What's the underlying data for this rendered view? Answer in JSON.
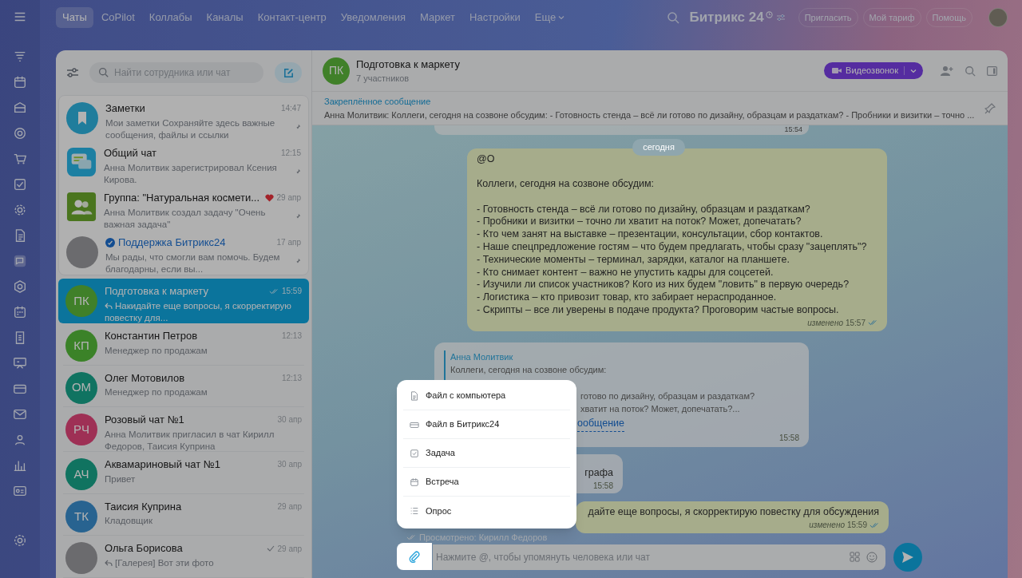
{
  "top_nav": {
    "items": [
      {
        "label": "Чаты",
        "selected": true
      },
      {
        "label": "CoPilot",
        "selected": false
      },
      {
        "label": "Коллабы",
        "selected": false
      },
      {
        "label": "Каналы",
        "selected": false
      },
      {
        "label": "Контакт-центр",
        "selected": false
      },
      {
        "label": "Уведомления",
        "selected": false
      },
      {
        "label": "Маркет",
        "selected": false
      },
      {
        "label": "Настройки",
        "selected": false
      }
    ],
    "more": "Еще",
    "brand": "Битрикс 24",
    "buttons": [
      "Пригласить",
      "Мой тариф",
      "Помощь"
    ]
  },
  "chat_list": {
    "search_placeholder": "Найти сотрудника или чат",
    "items": [
      {
        "title": "Заметки",
        "time": "14:47",
        "preview": "Мои заметки Сохраняйте здесь важные сообщения, файлы и ссылки",
        "kind": "notes",
        "pinned": true,
        "selected": false,
        "heart": false,
        "reply": false,
        "verified": false,
        "sent": false,
        "read": false
      },
      {
        "title": "Общий чат",
        "time": "12:15",
        "preview": "Анна Молитвик зарегистрировал Ксения Кирова.",
        "kind": "general",
        "pinned": true,
        "selected": false,
        "heart": false,
        "reply": false,
        "verified": false,
        "sent": false,
        "read": false
      },
      {
        "title": "Группа: \"Натуральная космети...",
        "time": "29 апр",
        "preview": "Анна Молитвик создал задачу \"Очень важная задача\"",
        "kind": "group",
        "pinned": true,
        "selected": false,
        "heart": true,
        "reply": false,
        "verified": false,
        "sent": false,
        "read": false
      },
      {
        "title": "Поддержка Битрикс24",
        "time": "17 апр",
        "preview": "Мы рады, что смогли вам помочь. Будем благодарны, если вы...",
        "kind": "photo",
        "pinned": true,
        "selected": false,
        "heart": false,
        "reply": false,
        "verified": true,
        "sent": false,
        "read": false
      },
      {
        "title": "Подготовка к маркету",
        "time": "15:59",
        "preview": "Накидайте еще вопросы, я скорректирую повестку для...",
        "kind": "initials",
        "initials": "ПК",
        "pinned": false,
        "selected": true,
        "heart": false,
        "reply": true,
        "verified": false,
        "sent": true,
        "read": true
      },
      {
        "title": "Константин Петров",
        "time": "12:13",
        "preview": "Менеджер по продажам",
        "kind": "initials",
        "initials": "КП",
        "pinned": false,
        "selected": false,
        "heart": false,
        "reply": false,
        "verified": false,
        "sent": false,
        "read": false
      },
      {
        "title": "Олег Мотовилов",
        "time": "12:13",
        "preview": "Менеджер по продажам",
        "kind": "initials",
        "initials": "ОМ",
        "pinned": false,
        "selected": false,
        "heart": false,
        "reply": false,
        "verified": false,
        "sent": false,
        "read": false
      },
      {
        "title": "Розовый чат №1",
        "time": "30 апр",
        "preview": "Анна Молитвик пригласил в чат Кирилл Федоров, Таисия Куприна",
        "kind": "initials",
        "initials": "РЧ",
        "pinned": false,
        "selected": false,
        "heart": false,
        "reply": false,
        "verified": false,
        "sent": false,
        "read": false
      },
      {
        "title": "Аквамариновый чат №1",
        "time": "30 апр",
        "preview": "Привет",
        "kind": "initials",
        "initials": "АЧ",
        "pinned": false,
        "selected": false,
        "heart": false,
        "reply": false,
        "verified": false,
        "sent": false,
        "read": false
      },
      {
        "title": "Таисия Куприна",
        "time": "29 апр",
        "preview": "Кладовщик",
        "kind": "initials",
        "initials": "ТК",
        "pinned": false,
        "selected": false,
        "heart": false,
        "reply": false,
        "verified": false,
        "sent": false,
        "read": false
      },
      {
        "title": "Ольга Борисова",
        "time": "29 апр",
        "preview": "[Галерея] Вот эти фото",
        "kind": "photo",
        "pinned": false,
        "selected": false,
        "heart": false,
        "reply": true,
        "verified": false,
        "sent": true,
        "read": false
      }
    ]
  },
  "chat": {
    "avatar_initials": "ПК",
    "title": "Подготовка к маркету",
    "subtitle": "7 участников",
    "video_button": "Видеозвонок",
    "pinned": {
      "label": "Закреплённое сообщение",
      "text": "Анна Молитвик: Коллеги, сегодня на созвоне обсудим: - Готовность стенда – всё ли готово по дизайну, образцам и раздаткам? - Пробники и визитки – точно ..."
    },
    "top_time": "15:54",
    "date_chip": "сегодня",
    "messages": [
      {
        "kind": "own",
        "text": "@О\n\nКоллеги, сегодня на созвоне обсудим:\n\n- Готовность стенда – всё ли готово по дизайну, образцам и раздаткам?\n- Пробники и визитки – точно ли хватит на поток? Может, допечатать?\n- Кто чем занят на выставке – презентации, консультации, сбор контактов.\n- Наше спецпредложение гостям – что будем предлагать, чтобы сразу \"зацеплять\"?\n- Технические моменты – терминал, зарядки, каталог на планшете.\n- Кто снимает контент – важно не упустить кадры для соцсетей.\n- Изучили ли список участников? Кого из них будем \"ловить\" в первую очередь?\n- Логистика – кто привозит товар, кто забирает нераспроданное.\n- Скрипты – все ли уверены в подаче продукта? Проговорим частые вопросы.",
        "edited": "изменено",
        "time": "15:57",
        "read": true
      },
      {
        "kind": "quote",
        "author": "Анна Молитвик",
        "text": "Коллеги, сегодня на созвоне обсудим:",
        "fragments": [
          "готово по дизайну, образцам и раздаткам?",
          "хватит на поток? Может, допечатать?..."
        ],
        "link": "ообщение",
        "time": "15:58"
      },
      {
        "kind": "incoming",
        "text": "графа",
        "time": "15:58"
      },
      {
        "kind": "own",
        "text": "дайте еще вопросы, я скорректирую повестку для обсуждения",
        "edited": "изменено",
        "time": "15:59",
        "read": true
      }
    ],
    "seen": "Просмотрено: Кирилл Федоров",
    "composer_placeholder": "Нажмите @, чтобы упомянуть человека или чат"
  },
  "attach_menu": [
    {
      "label": "Файл с компьютера"
    },
    {
      "label": "Файл в Битрикс24"
    },
    {
      "label": "Задача"
    },
    {
      "label": "Встреча"
    },
    {
      "label": "Опрос"
    }
  ]
}
